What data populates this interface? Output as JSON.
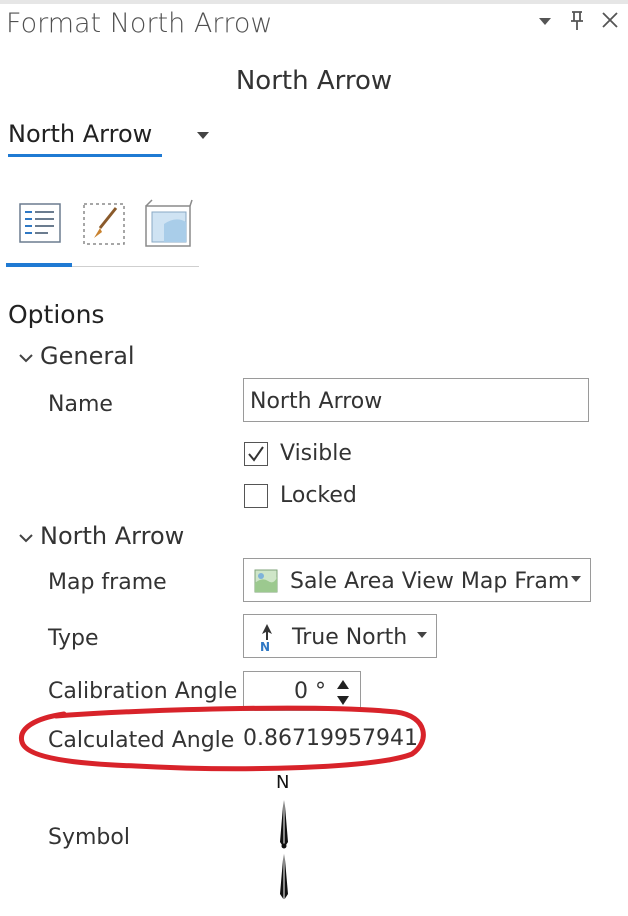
{
  "window": {
    "title": "Format North Arrow",
    "buttons": {
      "menu_icon": "dropdown-caret",
      "pin_icon": "pin",
      "close_icon": "close"
    }
  },
  "pane": {
    "subtitle": "North Arrow",
    "element_selector": "North Arrow",
    "tabs": [
      {
        "icon": "options-list-icon",
        "active": true
      },
      {
        "icon": "paintbrush-icon",
        "active": false
      },
      {
        "icon": "display-frame-icon",
        "active": false
      }
    ]
  },
  "options": {
    "header": "Options",
    "general": {
      "header": "General",
      "name_label": "Name",
      "name_value": "North Arrow",
      "visible_label": "Visible",
      "visible_checked": true,
      "locked_label": "Locked",
      "locked_checked": false
    },
    "north_arrow": {
      "header": "North Arrow",
      "map_frame_label": "Map frame",
      "map_frame_value": "Sale Area View Map Fram",
      "type_label": "Type",
      "type_value": "True North",
      "calibration_label": "Calibration Angle",
      "calibration_value": "0 °",
      "calculated_label": "Calculated Angle",
      "calculated_value": "0.86719957941",
      "symbol_label": "Symbol",
      "symbol_letter": "N"
    }
  },
  "colors": {
    "accent": "#1f7ad3",
    "annotation": "#d8232a"
  }
}
